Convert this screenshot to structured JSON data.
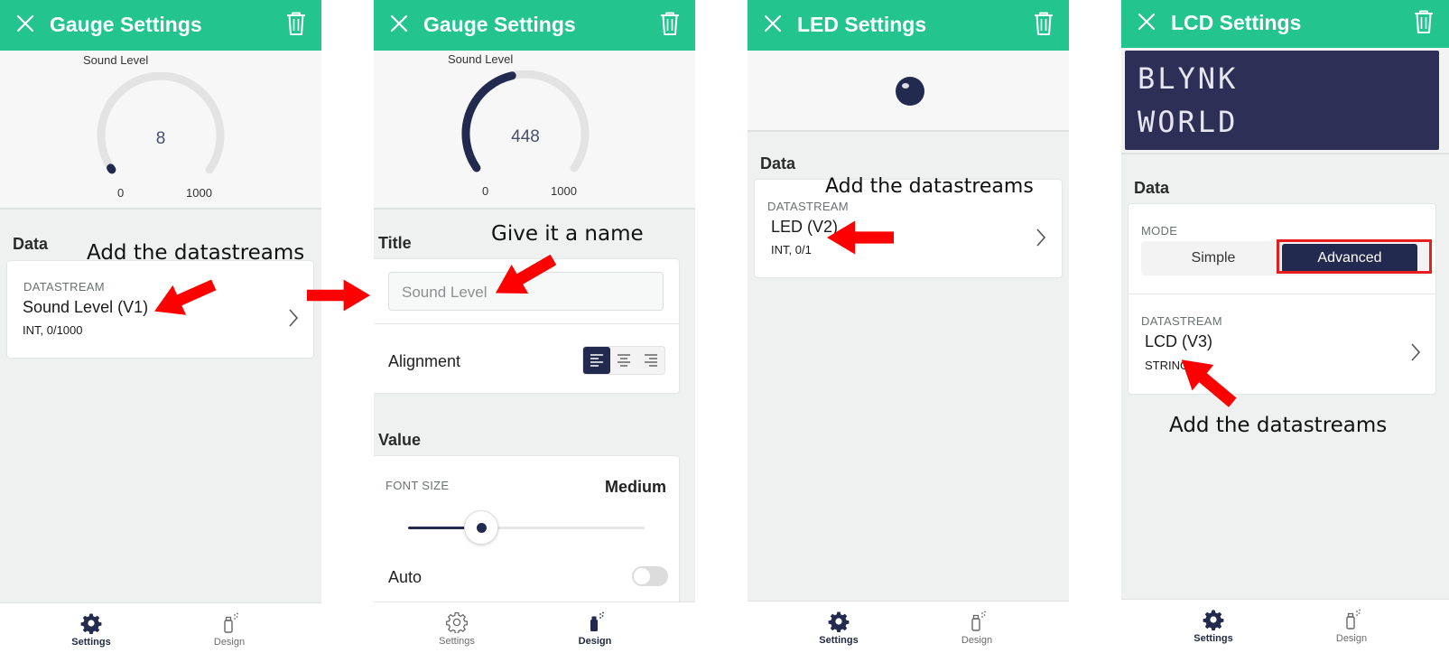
{
  "colors": {
    "brand_green": "#23c48e",
    "navy": "#222a4f",
    "annotation_red": "#ff0000",
    "lcd_bg": "#2d2f57"
  },
  "gauge_screen": {
    "title": "Gauge Settings",
    "close_icon": "close-icon",
    "delete_icon": "trash-icon",
    "preview": {
      "label": "Sound Level",
      "value": "8",
      "min": "0",
      "max": "1000",
      "fill_fraction": 0.008
    },
    "data_section": "Data",
    "datastream": {
      "caption": "DATASTREAM",
      "name": "Sound Level (V1)",
      "meta": "INT, 0/1000"
    },
    "annotation": "Add the datastreams",
    "tabs": [
      {
        "label": "Settings",
        "icon": "gear-icon",
        "active": true
      },
      {
        "label": "Design",
        "icon": "paint-spray-icon",
        "active": false
      }
    ]
  },
  "gauge_design_screen": {
    "title": "Gauge Settings",
    "preview": {
      "label": "Sound Level",
      "value": "448",
      "min": "0",
      "max": "1000",
      "fill_fraction": 0.448
    },
    "title_section": "Title",
    "title_input": {
      "placeholder": "Sound Level"
    },
    "annotation": "Give it a name",
    "alignment": {
      "label": "Alignment",
      "options": [
        "left",
        "center",
        "right"
      ],
      "selected": "left"
    },
    "value_section": "Value",
    "font_size": {
      "caption": "FONT SIZE",
      "value": "Medium",
      "slider_fraction": 0.31
    },
    "auto": {
      "label": "Auto",
      "on": false
    },
    "tabs": [
      {
        "label": "Settings",
        "icon": "gear-outline-icon",
        "active": false
      },
      {
        "label": "Design",
        "icon": "paint-spray-icon",
        "active": true
      }
    ]
  },
  "led_screen": {
    "title": "LED Settings",
    "data_section": "Data",
    "datastream": {
      "caption": "DATASTREAM",
      "name": "LED (V2)",
      "meta": "INT, 0/1"
    },
    "annotation": "Add the datastreams",
    "tabs": [
      {
        "label": "Settings",
        "icon": "gear-icon",
        "active": true
      },
      {
        "label": "Design",
        "icon": "paint-spray-icon",
        "active": false
      }
    ]
  },
  "lcd_screen": {
    "title": "LCD Settings",
    "lcd_lines": [
      "BLYNK",
      "WORLD"
    ],
    "data_section": "Data",
    "mode": {
      "caption": "MODE",
      "options": [
        "Simple",
        "Advanced"
      ],
      "selected": "Advanced"
    },
    "datastream": {
      "caption": "DATASTREAM",
      "name": "LCD (V3)",
      "meta": "STRING"
    },
    "annotation": "Add the datastreams",
    "tabs": [
      {
        "label": "Settings",
        "icon": "gear-icon",
        "active": true
      },
      {
        "label": "Design",
        "icon": "paint-spray-icon",
        "active": false
      }
    ]
  }
}
